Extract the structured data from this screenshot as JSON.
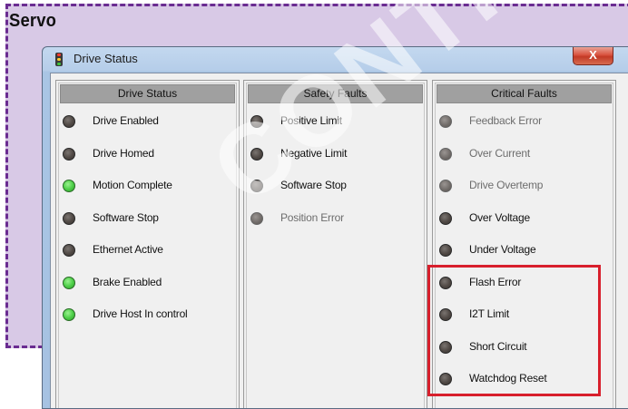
{
  "heading": {
    "title": "Servo"
  },
  "window": {
    "title": "Drive Status",
    "close_label": "X",
    "icon": "traffic-light-icon"
  },
  "colors": {
    "led_on": "#4fd04a",
    "led_off": "#4f4844",
    "highlight": "#d81f2c",
    "servo_border": "#6a2c91"
  },
  "panels": [
    {
      "title": "Drive Status",
      "items": [
        {
          "label": "Drive Enabled",
          "state": "off"
        },
        {
          "label": "Drive Homed",
          "state": "off"
        },
        {
          "label": "Motion Complete",
          "state": "on"
        },
        {
          "label": "Software Stop",
          "state": "off"
        },
        {
          "label": "Ethernet Active",
          "state": "off"
        },
        {
          "label": "Brake Enabled",
          "state": "on"
        },
        {
          "label": "Drive Host In control",
          "state": "on"
        }
      ]
    },
    {
      "title": "Safety Faults",
      "items": [
        {
          "label": "Positive Limit",
          "state": "off"
        },
        {
          "label": "Negative Limit",
          "state": "off"
        },
        {
          "label": "Software Stop",
          "state": "off"
        },
        {
          "label": "Position Error",
          "state": "dim"
        }
      ]
    },
    {
      "title": "Critical Faults",
      "items": [
        {
          "label": "Feedback Error",
          "state": "dim"
        },
        {
          "label": "Over Current",
          "state": "dim"
        },
        {
          "label": "Drive Overtemp",
          "state": "dim"
        },
        {
          "label": "Over Voltage",
          "state": "off"
        },
        {
          "label": "Under Voltage",
          "state": "off"
        },
        {
          "label": "Flash Error",
          "state": "off"
        },
        {
          "label": "I2T Limit",
          "state": "off"
        },
        {
          "label": "Short Circuit",
          "state": "off"
        },
        {
          "label": "Watchdog Reset",
          "state": "off"
        }
      ]
    }
  ],
  "watermark": "CONTINU"
}
